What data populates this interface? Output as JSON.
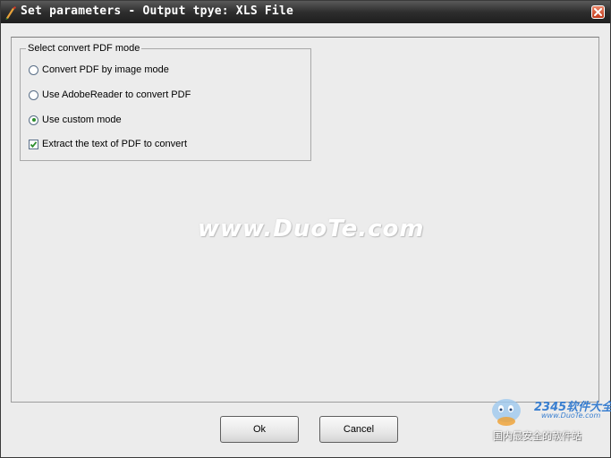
{
  "window": {
    "title": "Set parameters - Output tpye: XLS File"
  },
  "group": {
    "legend": "Select convert PDF mode",
    "options": [
      {
        "label": "Convert PDF by image mode",
        "type": "radio",
        "checked": false
      },
      {
        "label": "Use AdobeReader to convert PDF",
        "type": "radio",
        "checked": false
      },
      {
        "label": "Use custom mode",
        "type": "radio",
        "checked": true
      },
      {
        "label": "Extract the text of PDF to convert",
        "type": "checkbox",
        "checked": true
      }
    ]
  },
  "buttons": {
    "ok_label": "Ok",
    "cancel_label": "Cancel"
  },
  "watermark": {
    "center_text": "www.DuoTe.com",
    "logo_text": "2345软件大全",
    "logo_url": "www.DuoTe.com",
    "logo_tagline": "国内最安全的软件站"
  },
  "icons": {
    "app": "pdf-converter-app-icon",
    "close": "close-icon",
    "check": "checkmark-icon",
    "logo": "mascot-logo-icon"
  },
  "colors": {
    "titlebar": "#2e2e2e",
    "close_button": "#c0391b",
    "radio_dot": "#2d8e2d",
    "panel_bg": "#ececec",
    "logo_blue": "#3a7fd0"
  }
}
